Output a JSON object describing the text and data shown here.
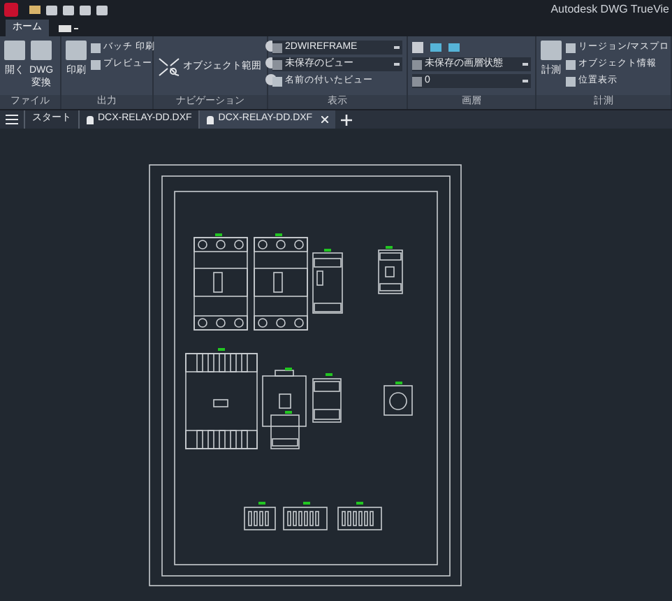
{
  "app_title": "Autodesk DWG TrueVie",
  "ribbon_tabs": [
    {
      "kind": "text",
      "label": "ホーム",
      "selected": true
    },
    {
      "kind": "icon",
      "selected": false
    }
  ],
  "panels": [
    {
      "title": "ファイル",
      "items": [
        {
          "kind": "large",
          "label": "開く"
        },
        {
          "kind": "large",
          "label": "DWG\n変換"
        }
      ]
    },
    {
      "title": "出力",
      "items": [
        {
          "kind": "large",
          "label": "印刷"
        },
        {
          "kind": "small",
          "label": "バッチ 印刷"
        },
        {
          "kind": "small",
          "label": "プレビュー"
        }
      ]
    },
    {
      "title": "ナビゲーション",
      "items": [
        {
          "kind": "wide",
          "label": "オブジェクト範囲"
        }
      ]
    },
    {
      "title": "表示",
      "items": [
        {
          "kind": "dropdown",
          "label": "2DWIREFRAME"
        },
        {
          "kind": "dropdown",
          "label": "未保存のビュー"
        },
        {
          "kind": "small",
          "label": "名前の付いたビュー"
        }
      ]
    },
    {
      "title": "画層",
      "items": [
        {
          "kind": "icons"
        },
        {
          "kind": "dropdown",
          "label": "未保存の画層状態"
        },
        {
          "kind": "dropdown",
          "label": "0"
        }
      ]
    },
    {
      "title": "計測",
      "items": [
        {
          "kind": "large",
          "label": "計測"
        },
        {
          "kind": "small",
          "label": "リージョン/マスプロ"
        },
        {
          "kind": "small",
          "label": "オブジェクト情報"
        },
        {
          "kind": "small",
          "label": "位置表示"
        }
      ]
    }
  ],
  "doc_tabs": [
    {
      "label": "スタート",
      "locked": false,
      "selected": false
    },
    {
      "label": "DCX-RELAY-DD.DXF",
      "locked": true,
      "selected": false
    },
    {
      "label": "DCX-RELAY-DD.DXF",
      "locked": true,
      "selected": true
    }
  ]
}
